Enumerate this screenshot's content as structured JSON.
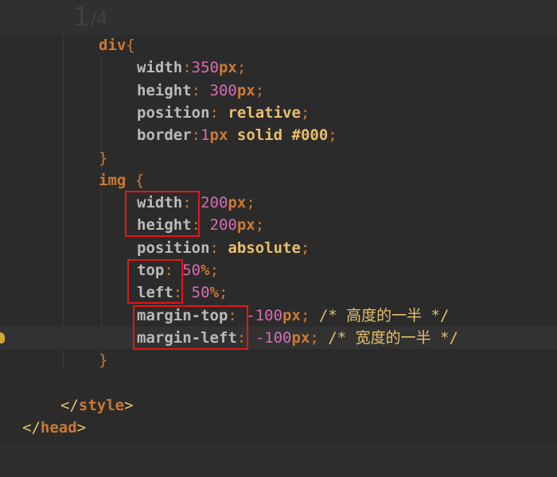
{
  "editor": {
    "page_indicator": {
      "current": "1",
      "total": "/4"
    },
    "lines": [
      {
        "indent": 124,
        "tokens": [
          [
            "kw",
            "div"
          ],
          [
            "brk",
            "{"
          ]
        ]
      },
      {
        "indent": 172,
        "tokens": [
          [
            "prop",
            "width"
          ],
          [
            "punc",
            ":"
          ],
          [
            "num",
            "350"
          ],
          [
            "unit",
            "px"
          ],
          [
            "punc",
            ";"
          ]
        ]
      },
      {
        "indent": 172,
        "tokens": [
          [
            "prop",
            "height"
          ],
          [
            "punc",
            ": "
          ],
          [
            "num",
            "300"
          ],
          [
            "unit",
            "px"
          ],
          [
            "punc",
            ";"
          ]
        ]
      },
      {
        "indent": 172,
        "tokens": [
          [
            "prop",
            "position"
          ],
          [
            "punc",
            ": "
          ],
          [
            "val",
            "relative"
          ],
          [
            "punc",
            ";"
          ]
        ]
      },
      {
        "indent": 172,
        "tokens": [
          [
            "prop",
            "border"
          ],
          [
            "punc",
            ":"
          ],
          [
            "num",
            "1"
          ],
          [
            "unit",
            "px "
          ],
          [
            "val",
            "solid #000"
          ],
          [
            "punc",
            ";"
          ]
        ]
      },
      {
        "indent": 124,
        "tokens": [
          [
            "brk",
            "}"
          ]
        ]
      },
      {
        "indent": 124,
        "tokens": [
          [
            "kw",
            "img "
          ],
          [
            "brk",
            "{"
          ]
        ]
      },
      {
        "indent": 172,
        "tokens": [
          [
            "prop",
            "width"
          ],
          [
            "punc",
            ": "
          ],
          [
            "num",
            "200"
          ],
          [
            "unit",
            "px"
          ],
          [
            "punc",
            ";"
          ]
        ]
      },
      {
        "indent": 172,
        "tokens": [
          [
            "prop",
            "height"
          ],
          [
            "punc",
            ": "
          ],
          [
            "num",
            "200"
          ],
          [
            "unit",
            "px"
          ],
          [
            "punc",
            ";"
          ]
        ]
      },
      {
        "indent": 172,
        "tokens": [
          [
            "prop",
            "position"
          ],
          [
            "punc",
            ": "
          ],
          [
            "val",
            "absolute"
          ],
          [
            "punc",
            ";"
          ]
        ]
      },
      {
        "indent": 172,
        "tokens": [
          [
            "prop",
            "top"
          ],
          [
            "punc",
            ": "
          ],
          [
            "num",
            "50"
          ],
          [
            "unit",
            "%"
          ],
          [
            "punc",
            ";"
          ]
        ]
      },
      {
        "indent": 172,
        "tokens": [
          [
            "prop",
            "left"
          ],
          [
            "punc",
            ": "
          ],
          [
            "num",
            "50"
          ],
          [
            "unit",
            "%"
          ],
          [
            "punc",
            ";"
          ]
        ]
      },
      {
        "indent": 172,
        "tokens": [
          [
            "prop",
            "margin-top"
          ],
          [
            "punc",
            ": "
          ],
          [
            "num",
            "-100"
          ],
          [
            "unit",
            "px"
          ],
          [
            "punc",
            "; "
          ],
          [
            "cmt",
            "/* 高度的一半 */"
          ]
        ]
      },
      {
        "indent": 172,
        "tokens": [
          [
            "prop",
            "margin-left"
          ],
          [
            "punc",
            ": "
          ],
          [
            "num",
            "-100"
          ],
          [
            "unit",
            "px"
          ],
          [
            "punc",
            "; "
          ],
          [
            "cmt",
            "/* 宽度的一半 */"
          ]
        ],
        "current": true
      },
      {
        "indent": 124,
        "tokens": [
          [
            "brk",
            "}"
          ]
        ]
      },
      {
        "indent": 0,
        "tokens": []
      },
      {
        "indent": 76,
        "tokens": [
          [
            "tag",
            "</"
          ],
          [
            "kw",
            "style"
          ],
          [
            "tag",
            ">"
          ]
        ]
      },
      {
        "indent": 28,
        "tokens": [
          [
            "tag",
            "</"
          ],
          [
            "kw",
            "head"
          ],
          [
            "tag",
            ">"
          ]
        ]
      }
    ]
  }
}
